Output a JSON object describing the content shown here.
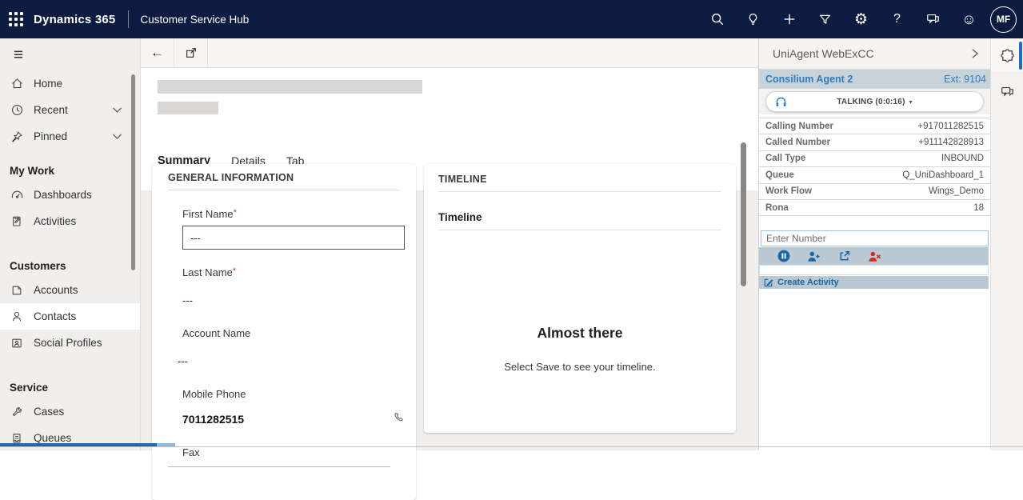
{
  "navbar": {
    "product": "Dynamics 365",
    "app_name": "Customer Service Hub",
    "avatar_initials": "MF",
    "icon_names": [
      "search-icon",
      "lightbulb-icon",
      "add-icon",
      "filter-icon",
      "settings-icon",
      "help-icon",
      "feedback-icon",
      "emoji-icon"
    ]
  },
  "glyphs": {
    "gear": "⚙",
    "help": "?",
    "smiley": "☺",
    "back": "←",
    "hamburger": "≡",
    "caret_down": "▾"
  },
  "sidebar": {
    "sections": [
      "My Work",
      "Customers",
      "Service"
    ],
    "items": [
      {
        "label": "Home"
      },
      {
        "label": "Recent"
      },
      {
        "label": "Pinned"
      },
      {
        "label": "Dashboards"
      },
      {
        "label": "Activities"
      },
      {
        "label": "Accounts"
      },
      {
        "label": "Contacts",
        "selected": true
      },
      {
        "label": "Social Profiles"
      },
      {
        "label": "Cases"
      },
      {
        "label": "Queues"
      }
    ]
  },
  "tabs": [
    {
      "label": "Summary",
      "active": true
    },
    {
      "label": "Details",
      "active": false
    },
    {
      "label": "Tab",
      "active": false
    }
  ],
  "general_info": {
    "title": "GENERAL INFORMATION",
    "fields": [
      {
        "label": "First Name",
        "required": "*",
        "value": "---"
      },
      {
        "label": "Last Name",
        "required": "*",
        "value": "---"
      },
      {
        "label": "Account Name",
        "value": "---"
      },
      {
        "label": "Mobile Phone",
        "value": "7011282515"
      },
      {
        "label": "Fax"
      }
    ]
  },
  "timeline": {
    "title": "TIMELINE",
    "subtitle": "Timeline",
    "empty_title": "Almost there",
    "empty_message": "Select Save to see your timeline."
  },
  "call_panel": {
    "title": "UniAgent WebExCC",
    "agent_name": "Consilium Agent 2",
    "extension": "Ext: 9104",
    "status_label": "TALKING (0:0:16)",
    "details": [
      {
        "label": "Calling Number",
        "value": "+917011282515"
      },
      {
        "label": "Called Number",
        "value": "+911142828913"
      },
      {
        "label": "Call Type",
        "value": "INBOUND"
      },
      {
        "label": "Queue",
        "value": "Q_UniDashboard_1"
      },
      {
        "label": "Work Flow",
        "value": "Wings_Demo"
      },
      {
        "label": "Rona",
        "value": "18"
      }
    ],
    "dial_input_placeholder": "Enter Number",
    "create_activity_label": "Create Activity",
    "action_icon_names": [
      "hold-icon",
      "add-person-icon",
      "open-external-icon",
      "end-participant-icon"
    ]
  },
  "colors": {
    "navbar_bg": "#0b1c40",
    "tab_accent_blue": "#1f6cc4",
    "panel_link_blue": "#2e7cbd",
    "action_blue": "#1766a8",
    "danger_red": "#d42a1a",
    "required_red": "#c0392b",
    "required_blue": "#2266e3",
    "agent_bar_bg": "#c7d2d9",
    "action_bar_bg": "#b9c8d2"
  }
}
